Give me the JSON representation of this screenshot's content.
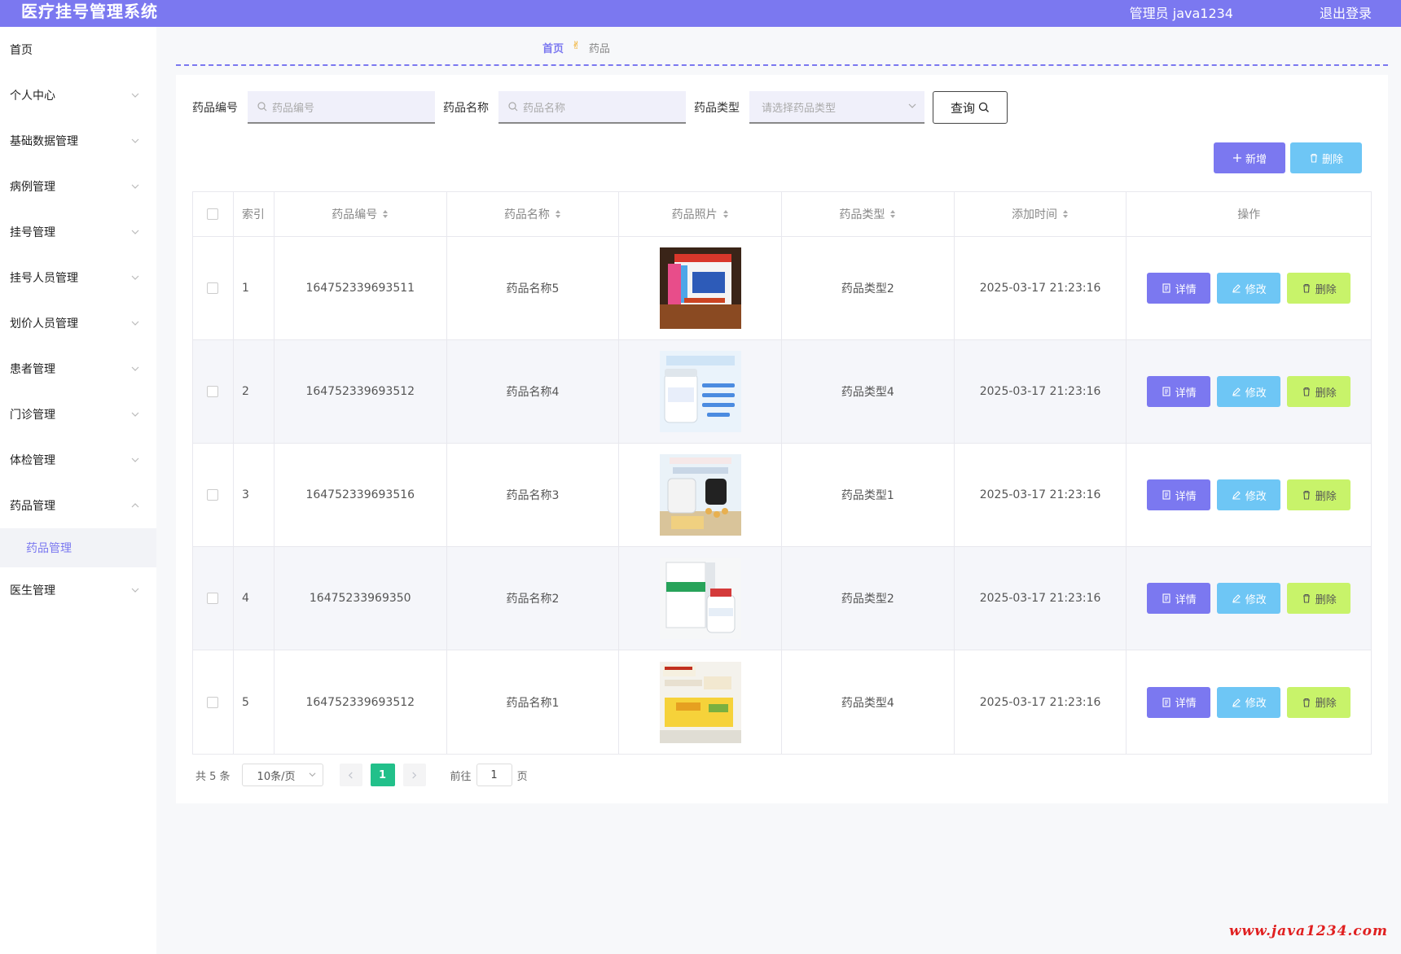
{
  "header": {
    "app_title": "医疗挂号管理系统",
    "admin_label": "管理员 java1234",
    "logout_label": "退出登录"
  },
  "sidebar": {
    "items": [
      {
        "label": "首页",
        "has_children": false
      },
      {
        "label": "个人中心",
        "has_children": true
      },
      {
        "label": "基础数据管理",
        "has_children": true
      },
      {
        "label": "病例管理",
        "has_children": true
      },
      {
        "label": "挂号管理",
        "has_children": true
      },
      {
        "label": "挂号人员管理",
        "has_children": true
      },
      {
        "label": "划价人员管理",
        "has_children": true
      },
      {
        "label": "患者管理",
        "has_children": true
      },
      {
        "label": "门诊管理",
        "has_children": true
      },
      {
        "label": "体检管理",
        "has_children": true
      },
      {
        "label": "药品管理",
        "has_children": true,
        "expanded": true
      },
      {
        "label": "医生管理",
        "has_children": true
      }
    ],
    "sub_items": {
      "drug": "药品管理"
    }
  },
  "breadcrumb": {
    "home": "首页",
    "current": "药品"
  },
  "filters": {
    "code_label": "药品编号",
    "code_placeholder": "药品编号",
    "name_label": "药品名称",
    "name_placeholder": "药品名称",
    "type_label": "药品类型",
    "type_placeholder": "请选择药品类型",
    "query_label": "查询"
  },
  "actions": {
    "add_label": "新增",
    "delete_label": "删除"
  },
  "table": {
    "headers": {
      "index": "索引",
      "code": "药品编号",
      "name": "药品名称",
      "photo": "药品照片",
      "type": "药品类型",
      "time": "添加时间",
      "op": "操作"
    },
    "rows": [
      {
        "index": "1",
        "code": "164752339693511",
        "name": "药品名称5",
        "type": "药品类型2",
        "time": "2025-03-17 21:23:16"
      },
      {
        "index": "2",
        "code": "164752339693512",
        "name": "药品名称4",
        "type": "药品类型4",
        "time": "2025-03-17 21:23:16"
      },
      {
        "index": "3",
        "code": "164752339693516",
        "name": "药品名称3",
        "type": "药品类型1",
        "time": "2025-03-17 21:23:16"
      },
      {
        "index": "4",
        "code": "16475233969350",
        "name": "药品名称2",
        "type": "药品类型2",
        "time": "2025-03-17 21:23:16"
      },
      {
        "index": "5",
        "code": "164752339693512",
        "name": "药品名称1",
        "type": "药品类型4",
        "time": "2025-03-17 21:23:16"
      }
    ],
    "row_actions": {
      "detail": "详情",
      "edit": "修改",
      "delete": "删除"
    }
  },
  "pagination": {
    "total": "共 5 条",
    "page_size": "10条/页",
    "current_page": "1",
    "goto_label": "前往",
    "goto_value": "1",
    "page_suffix": "页"
  },
  "watermark": "www.java1234.com",
  "colors": {
    "primary": "#7b78f0",
    "info": "#6ec6f5",
    "lime": "#c8f36a",
    "pager_active": "#22c08a"
  }
}
